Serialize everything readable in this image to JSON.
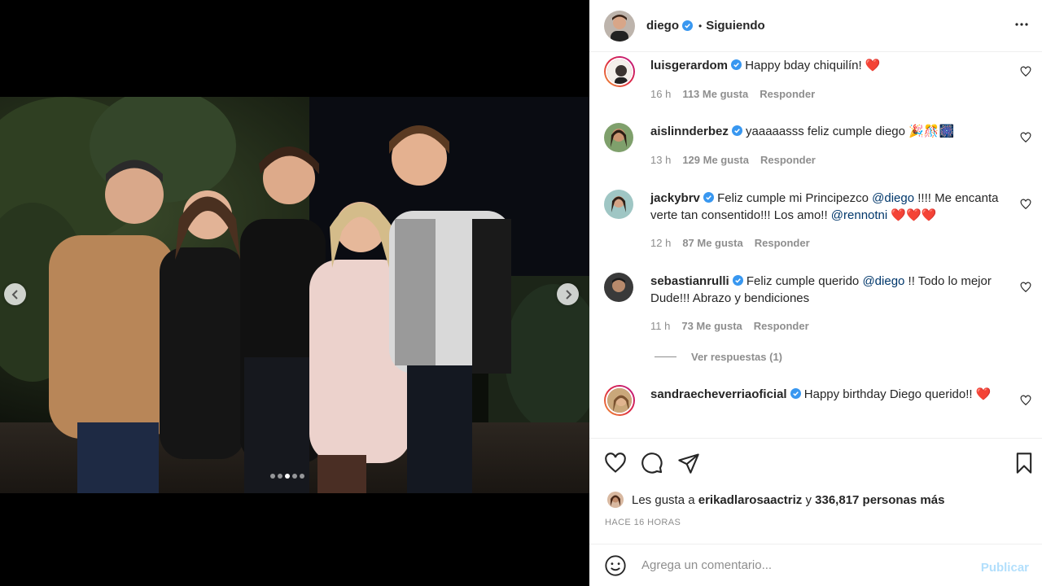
{
  "post": {
    "author": "diego",
    "follow_state": "Siguiendo",
    "bullet": "•"
  },
  "carousel": {
    "slide_count": 5,
    "active_index": 2
  },
  "comments": [
    {
      "username": "luisgerardom",
      "text": "Happy bday chiquilín! ❤️",
      "time": "16 h",
      "likes": "113 Me gusta",
      "reply": "Responder"
    },
    {
      "username": "aislinnderbez",
      "text": "yaaaaasss feliz cumple diego 🎉🎊🎆",
      "time": "13 h",
      "likes": "129 Me gusta",
      "reply": "Responder"
    },
    {
      "username": "jackybrv",
      "text_a": "Feliz cumple mi Principezco ",
      "mention_a": "@diego",
      "text_b": " !!!! Me encanta verte tan consentido!!! Los amo!! ",
      "mention_b": "@rennotni",
      "text_c": " ❤️❤️❤️",
      "time": "12 h",
      "likes": "87 Me gusta",
      "reply": "Responder"
    },
    {
      "username": "sebastianrulli",
      "text_a": "Feliz cumple querido ",
      "mention_a": "@diego",
      "text_b": " !! Todo lo mejor Dude!!! Abrazo y bendiciones",
      "time": "11 h",
      "likes": "73 Me gusta",
      "reply": "Responder",
      "view_replies": "Ver respuestas (1)"
    },
    {
      "username": "sandraecheverriaoficial",
      "text": "Happy birthday Diego querido!! ❤️"
    }
  ],
  "likes_summary": {
    "prefix": "Les gusta a ",
    "user": "erikadlarosaactriz",
    "middle": " y ",
    "count": "336,817 personas más"
  },
  "timestamp": "HACE 16 HORAS",
  "compose": {
    "placeholder": "Agrega un comentario...",
    "publish_label": "Publicar"
  },
  "colors": {
    "verified": "#3897f0",
    "mention": "#00376b",
    "publish": "#b2dffc"
  }
}
